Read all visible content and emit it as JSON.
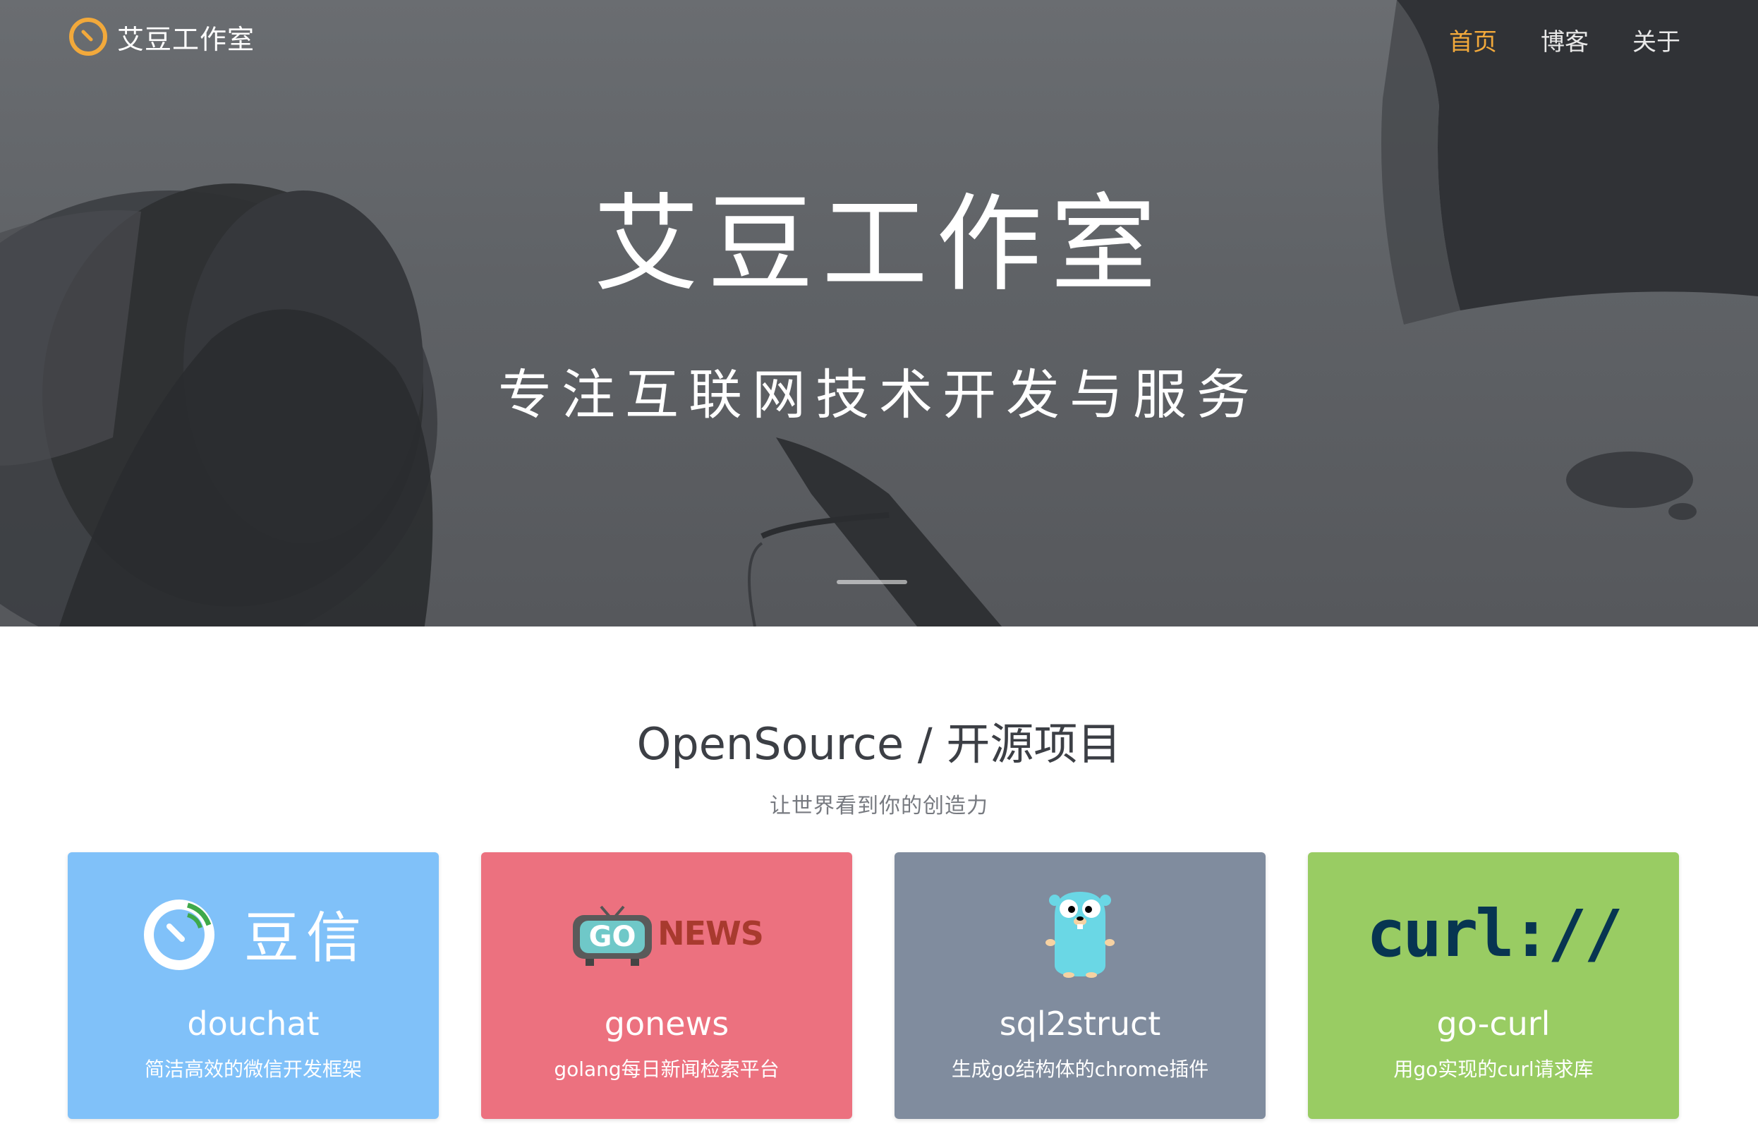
{
  "header": {
    "brand_name": "艾豆工作室",
    "nav": [
      {
        "label": "首页",
        "active": true
      },
      {
        "label": "博客",
        "active": false
      },
      {
        "label": "关于",
        "active": false
      }
    ]
  },
  "hero": {
    "title": "艾豆工作室",
    "subtitle": "专注互联网技术开发与服务"
  },
  "opensource": {
    "title": "OpenSource / 开源项目",
    "subtitle": "让世界看到你的创造力",
    "projects": [
      {
        "name": "douchat",
        "desc": "简洁高效的微信开发框架",
        "logo_text": "豆信",
        "logo_icon": "douchat-logo-icon",
        "color": "#80c1f9"
      },
      {
        "name": "gonews",
        "desc": "golang每日新闻检索平台",
        "logo_text": "NEWS",
        "logo_tv_text": "GO",
        "logo_icon": "gonews-tv-icon",
        "color": "#ec717f"
      },
      {
        "name": "sql2struct",
        "desc": "生成go结构体的chrome插件",
        "logo_icon": "gopher-icon",
        "color": "#808c9e"
      },
      {
        "name": "go-curl",
        "desc": "用go实现的curl请求库",
        "logo_text": "curl://",
        "logo_icon": "curl-logo-icon",
        "color": "#99cc63"
      }
    ]
  },
  "colors": {
    "accent": "#f2a93b",
    "hero_overlay": "#5f6266",
    "heading": "#3c3f45"
  }
}
